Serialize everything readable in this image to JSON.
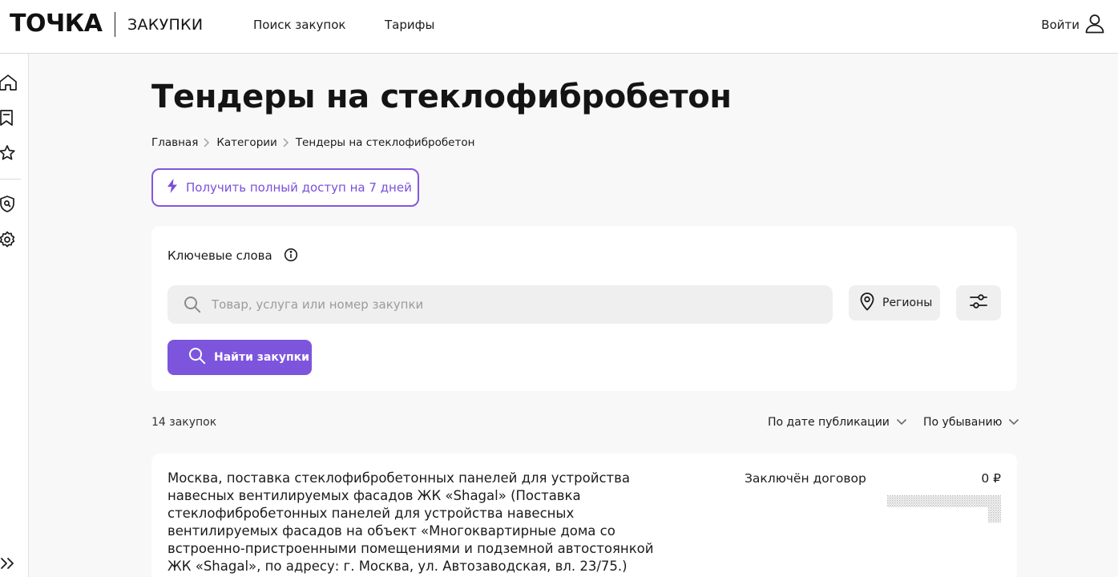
{
  "header": {
    "logo": "ТОЧКА",
    "logo_sub": "ЗАКУПКИ",
    "nav": [
      "Поиск закупок",
      "Тарифы"
    ],
    "login": "Войти"
  },
  "sidebar": {
    "icons": [
      "home-icon",
      "bookmark-icon",
      "star-icon",
      "shield-search-icon",
      "settings-icon"
    ],
    "expand_icon": "double-chevron-right-icon"
  },
  "page": {
    "title": "Тендеры на стеклофибробетон",
    "breadcrumb": [
      "Главная",
      "Категории",
      "Тендеры на стеклофибробетон"
    ]
  },
  "trial": {
    "label": "Получить полный доступ на 7 дней"
  },
  "search": {
    "keywords_label": "Ключевые слова",
    "placeholder": "Товар, услуга или номер закупки",
    "value": "",
    "regions_label": "Регионы",
    "find_label": "Найти закупки"
  },
  "results": {
    "count": "14 закупок",
    "sort_field": "По дате публикации",
    "sort_order": "По убыванию",
    "items": [
      {
        "title": "Москва, поставка стеклофибробетонных панелей для устройства навесных вентилируемых фасадов ЖК «Shagal» (Поставка стеклофибробетонных панелей для устройства навесных вентилируемых фасадов на объект «Многоквартирные дома со встроенно-пристроенными помещениями и подземной автостоянкой ЖК «Shagal», по адресу: г. Москва, ул. Автозаводская, вл. 23/75.)",
        "status": "Заключён договор",
        "price": "0 ₽"
      }
    ]
  },
  "colors": {
    "accent": "#7d55dd",
    "accent_border": "#8456e0",
    "page_bg": "#f8f8f8",
    "card_bg": "#ffffff",
    "field_bg": "#efefef"
  }
}
